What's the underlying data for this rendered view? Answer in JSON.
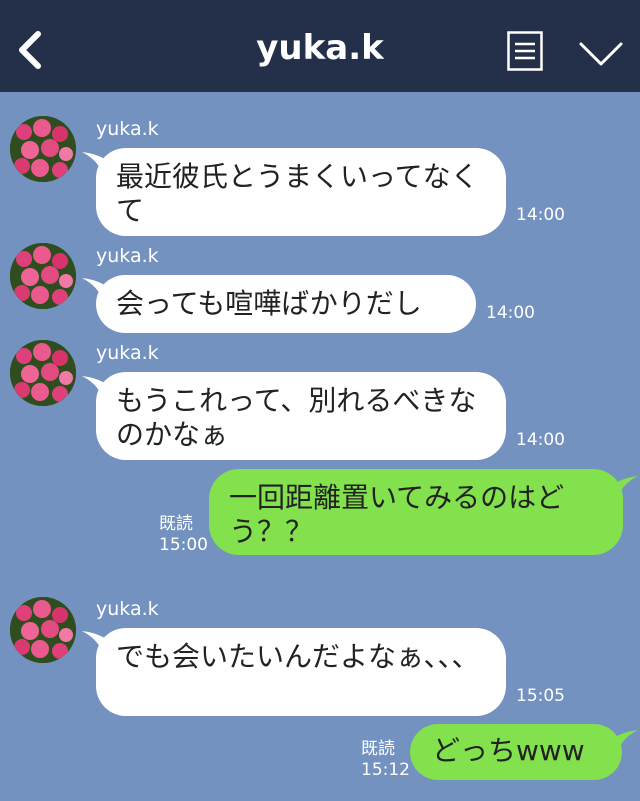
{
  "header": {
    "title": "yuka.k",
    "back_icon": "chevron-left-icon",
    "menu_icon": "notes-icon",
    "expand_icon": "chevron-down-icon",
    "bg_color": "#243049"
  },
  "chat": {
    "bg_color": "#7392c0",
    "messages": [
      {
        "direction": "incoming",
        "sender": "yuka.k",
        "text": "最近彼氏とうまくいってなくて",
        "time": "14:00"
      },
      {
        "direction": "incoming",
        "sender": "yuka.k",
        "text": "会っても喧嘩ばかりだし",
        "time": "14:00"
      },
      {
        "direction": "incoming",
        "sender": "yuka.k",
        "text": "もうこれって、別れるべきなのかなぁ",
        "time": "14:00"
      },
      {
        "direction": "outgoing",
        "text": "一回距離置いてみるのはどう？？",
        "read": "既読",
        "time": "15:00"
      },
      {
        "direction": "incoming",
        "sender": "yuka.k",
        "text": "でも会いたいんだよなぁ、、、",
        "time": "15:05"
      },
      {
        "direction": "outgoing",
        "text": "どっちwww",
        "read": "既読",
        "time": "15:12"
      }
    ]
  }
}
